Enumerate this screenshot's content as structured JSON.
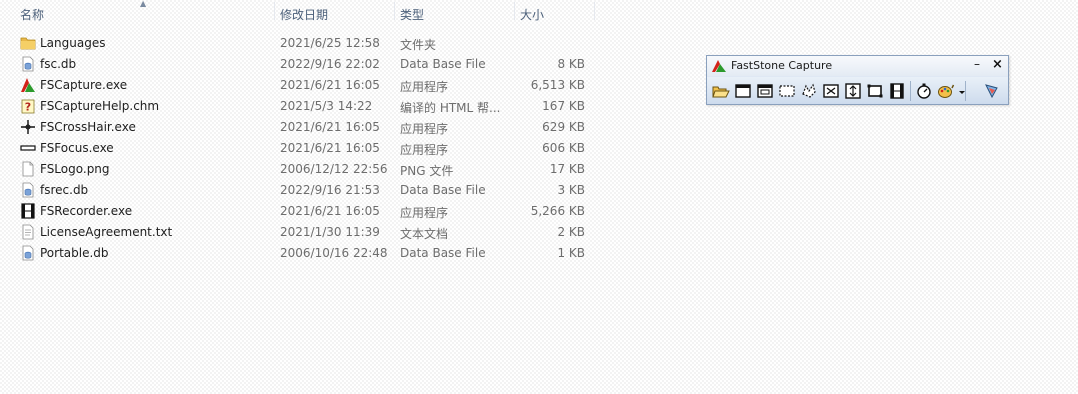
{
  "header": {
    "name": "名称",
    "modified": "修改日期",
    "type": "类型",
    "size": "大小"
  },
  "files": [
    {
      "name": "Languages",
      "modified": "2021/6/25 12:58",
      "type": "文件夹",
      "size": "",
      "icon": "folder-icon"
    },
    {
      "name": "fsc.db",
      "modified": "2022/9/16 22:02",
      "type": "Data Base File",
      "size": "8 KB",
      "icon": "db-file-icon"
    },
    {
      "name": "FSCapture.exe",
      "modified": "2021/6/21 16:05",
      "type": "应用程序",
      "size": "6,513 KB",
      "icon": "fscapture-app-icon"
    },
    {
      "name": "FSCaptureHelp.chm",
      "modified": "2021/5/3 14:22",
      "type": "编译的 HTML 帮...",
      "size": "167 KB",
      "icon": "help-file-icon"
    },
    {
      "name": "FSCrossHair.exe",
      "modified": "2021/6/21 16:05",
      "type": "应用程序",
      "size": "629 KB",
      "icon": "crosshair-icon"
    },
    {
      "name": "FSFocus.exe",
      "modified": "2021/6/21 16:05",
      "type": "应用程序",
      "size": "606 KB",
      "icon": "focus-bar-icon"
    },
    {
      "name": "FSLogo.png",
      "modified": "2006/12/12 22:56",
      "type": "PNG 文件",
      "size": "17 KB",
      "icon": "image-file-icon"
    },
    {
      "name": "fsrec.db",
      "modified": "2022/9/16 21:53",
      "type": "Data Base File",
      "size": "3 KB",
      "icon": "db-file-icon"
    },
    {
      "name": "FSRecorder.exe",
      "modified": "2021/6/21 16:05",
      "type": "应用程序",
      "size": "5,266 KB",
      "icon": "film-icon"
    },
    {
      "name": "LicenseAgreement.txt",
      "modified": "2021/1/30 11:39",
      "type": "文本文档",
      "size": "2 KB",
      "icon": "text-file-icon"
    },
    {
      "name": "Portable.db",
      "modified": "2006/10/16 22:48",
      "type": "Data Base File",
      "size": "1 KB",
      "icon": "db-file-icon"
    }
  ],
  "faststone": {
    "title": "FastStone Capture",
    "minimize_glyph": "–",
    "close_glyph": "×",
    "tools": [
      "open-file-icon",
      "capture-active-window-icon",
      "capture-window-object-icon",
      "capture-rectangle-icon",
      "capture-freehand-icon",
      "capture-fullscreen-icon",
      "capture-scrolling-icon",
      "capture-fixed-region-icon",
      "screen-recorder-icon",
      "delay-timer-icon",
      "output-destination-icon",
      "settings-menu-icon"
    ]
  },
  "colors": {
    "header_text": "#4c607a",
    "secondary_text": "#6d6d6d",
    "toolbar_border": "#8aa0bd",
    "folder": "#e8b84a",
    "accent_red": "#d3221a",
    "accent_green": "#2c9a2c"
  }
}
